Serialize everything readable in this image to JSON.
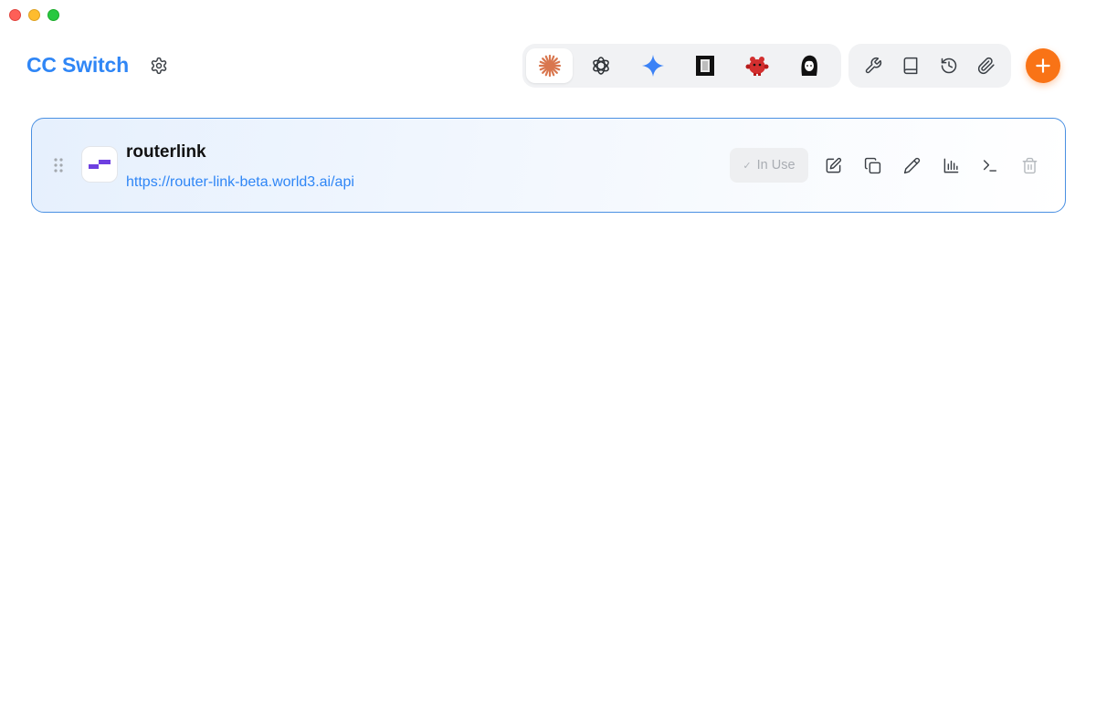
{
  "header": {
    "title": "CC Switch",
    "settings_icon": "gear-icon"
  },
  "app_tabs": [
    {
      "icon": "claude-icon",
      "active": true
    },
    {
      "icon": "openai-icon",
      "active": false
    },
    {
      "icon": "gemini-icon",
      "active": false
    },
    {
      "icon": "terminal-app-icon",
      "active": false
    },
    {
      "icon": "red-mascot-icon",
      "active": false
    },
    {
      "icon": "avatar-app-icon",
      "active": false
    }
  ],
  "tools": [
    {
      "icon": "wrench-icon"
    },
    {
      "icon": "book-icon"
    },
    {
      "icon": "history-icon"
    },
    {
      "icon": "paperclip-icon"
    }
  ],
  "add_button_icon": "plus-icon",
  "provider": {
    "name": "routerlink",
    "url": "https://router-link-beta.world3.ai/api",
    "status_label": "In Use",
    "actions": [
      "edit-icon",
      "copy-icon",
      "pencil-icon",
      "bar-chart-icon",
      "terminal-icon",
      "trash-icon"
    ]
  },
  "colors": {
    "accent": "#2f86f6",
    "add_button": "#f97316",
    "card_border": "#4a90e2",
    "claude_orange": "#d9774f",
    "gemini_blue": "#3b82f6",
    "mascot_red": "#d32f2f",
    "logo_purple": "#6d3fe0"
  }
}
